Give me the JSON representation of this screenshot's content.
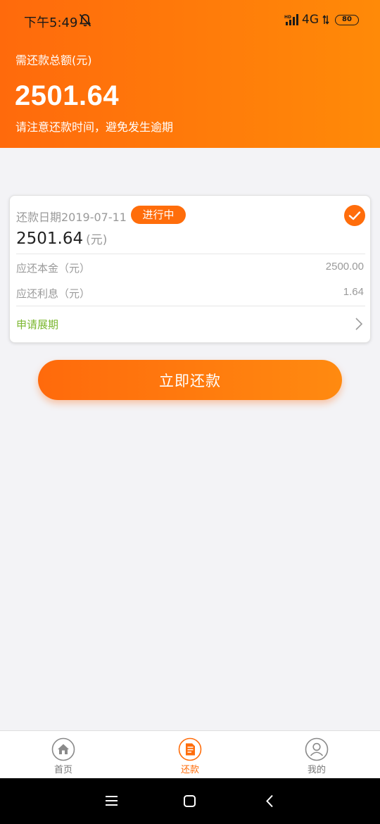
{
  "status_bar": {
    "time": "下午5:49",
    "network": "4G",
    "battery": "80"
  },
  "header": {
    "total_label": "需还款总额(元)",
    "total_amount": "2501.64",
    "notice": "请注意还款时间，避免发生逾期"
  },
  "bill": {
    "date": "还款日期2019-07-11",
    "status": "进行中",
    "amount": "2501.64",
    "amount_unit": "(元)",
    "principal_label": "应还本金（元）",
    "principal_value": "2500.00",
    "interest_label": "应还利息（元）",
    "interest_value": "1.64",
    "extend_label": "申请展期"
  },
  "actions": {
    "pay_now": "立即还款"
  },
  "tabbar": {
    "tabs": [
      {
        "label": "首页",
        "icon": "home-icon",
        "active": false
      },
      {
        "label": "还款",
        "icon": "repay-icon",
        "active": true
      },
      {
        "label": "我的",
        "icon": "profile-icon",
        "active": false
      }
    ]
  },
  "colors": {
    "accent": "#ff6d0b",
    "extend_green": "#7bb72f"
  }
}
